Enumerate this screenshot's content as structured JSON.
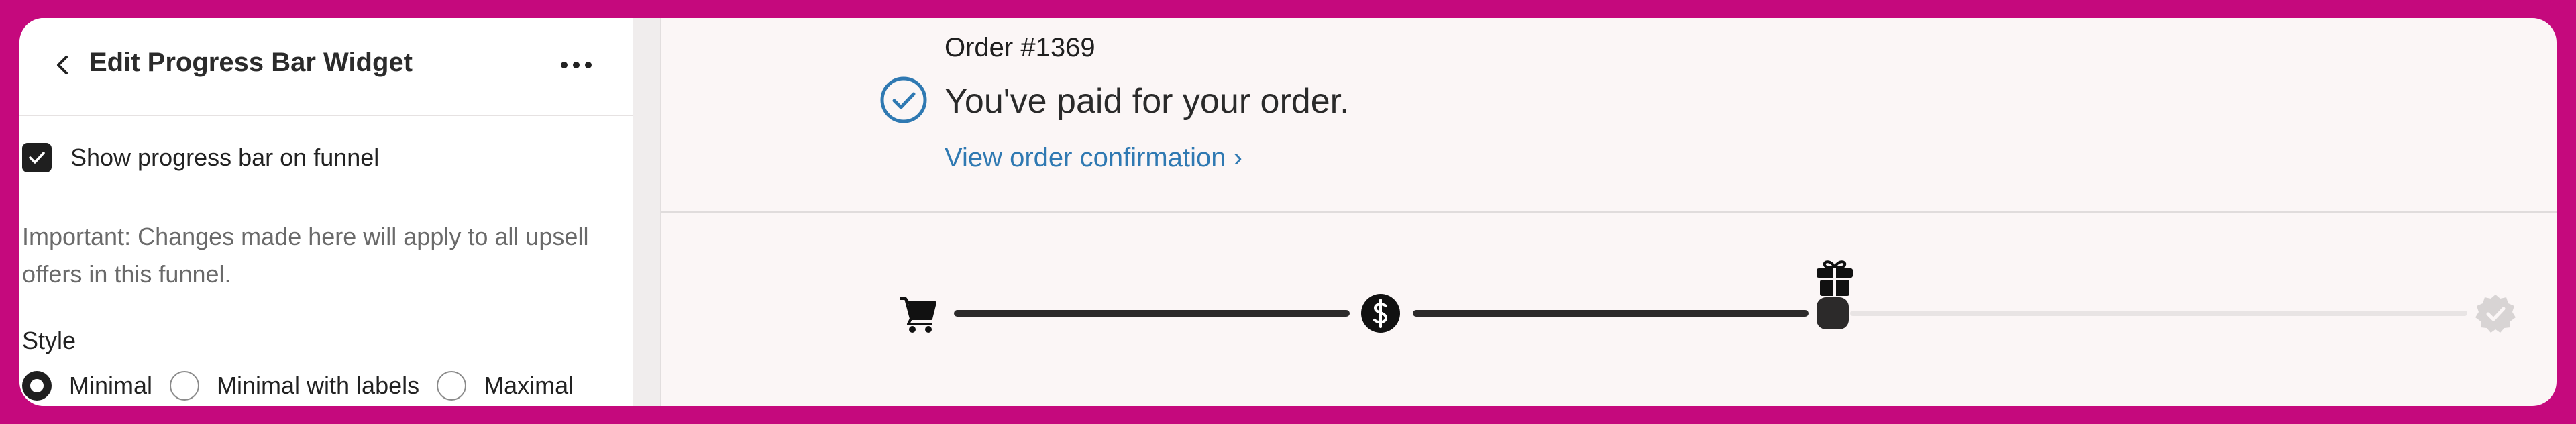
{
  "panel": {
    "title": "Edit Progress Bar Widget",
    "show_progress_label": "Show progress bar on funnel",
    "show_progress_checked": true,
    "note": "Important: Changes made here will apply to all upsell offers in this funnel.",
    "style_label": "Style",
    "style_options": [
      "Minimal",
      "Minimal with labels",
      "Maximal"
    ],
    "style_selected": "Minimal"
  },
  "preview": {
    "order_number": "Order #1369",
    "paid_message": "You've paid for your order.",
    "confirmation_link": "View order confirmation ›",
    "progress": {
      "steps": [
        "cart-icon",
        "dollar-icon",
        "gift-icon",
        "verified-badge-icon"
      ],
      "completed_fraction": 0.6,
      "done_color": "#2c2a2a",
      "todo_color": "#e8e4e4"
    }
  },
  "colors": {
    "frame": "#c5097d",
    "link": "#2f79b2",
    "check_blue": "#2f79b2"
  }
}
